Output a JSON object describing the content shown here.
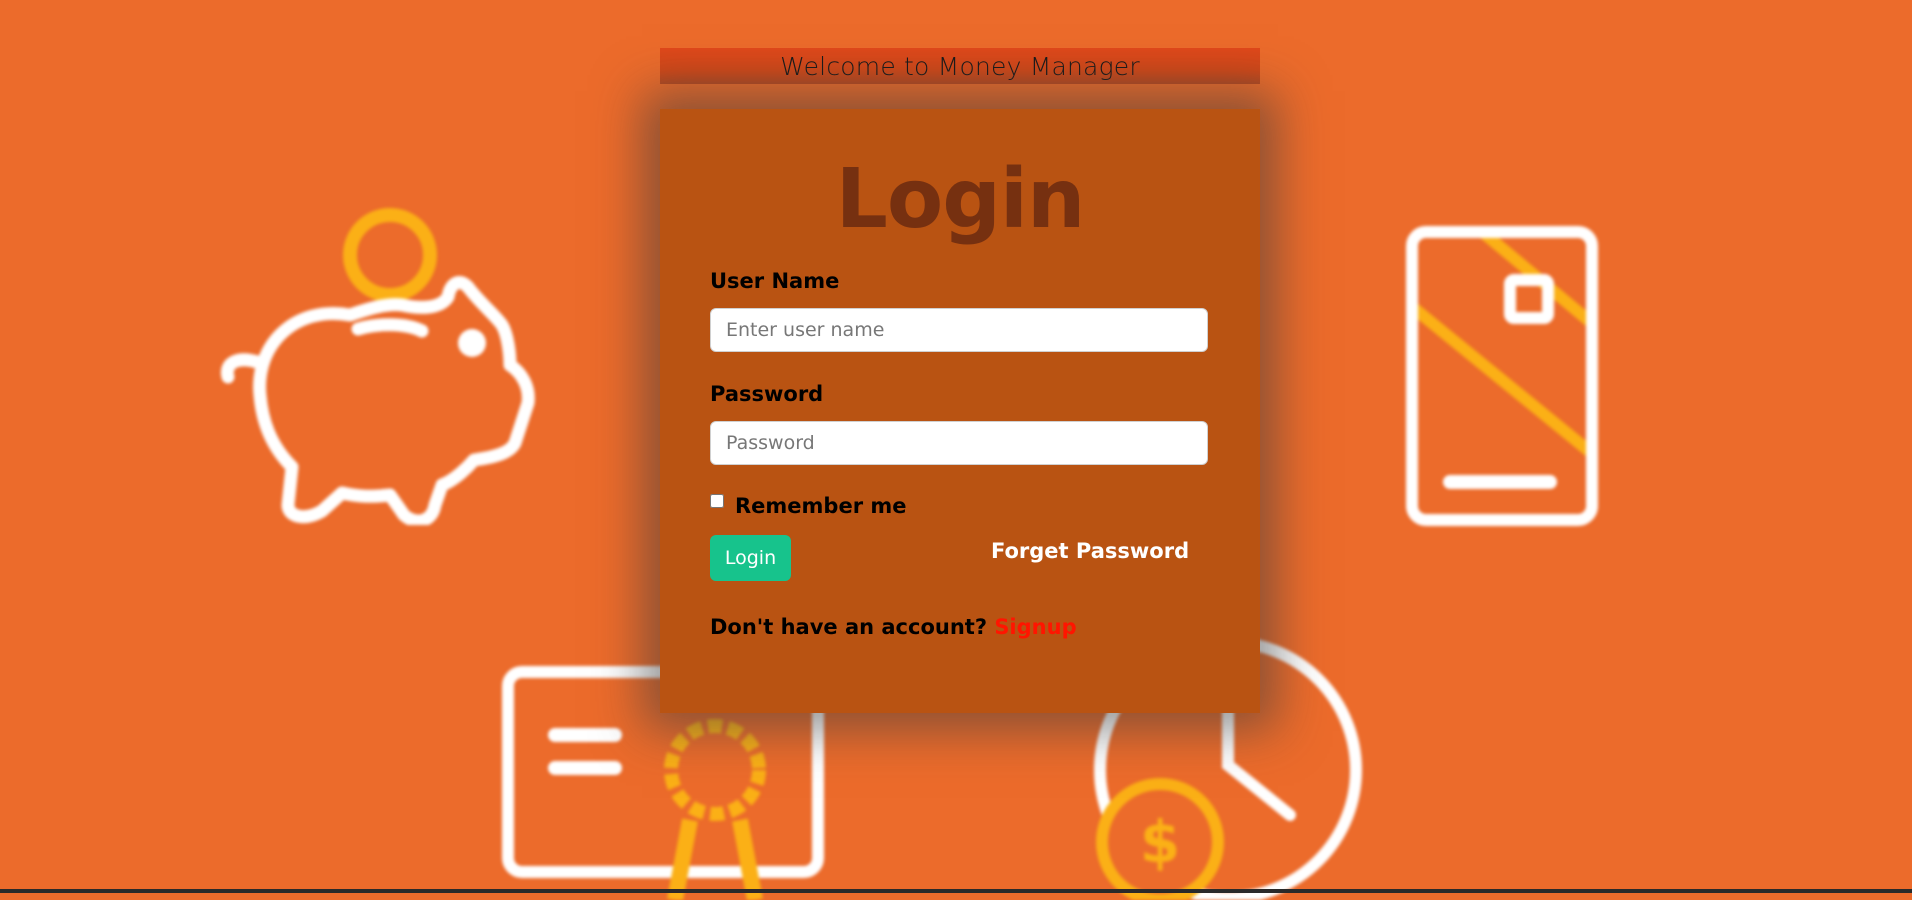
{
  "header": {
    "welcome": "Welcome to Money Manager"
  },
  "login_form": {
    "title": "Login",
    "username_label": "User Name",
    "username_placeholder": "Enter user name",
    "username_value": "",
    "password_label": "Password",
    "password_placeholder": "Password",
    "password_value": "",
    "remember_label": "Remember me",
    "remember_checked": false,
    "login_button": "Login",
    "forget_password": "Forget Password",
    "no_account_text": "Don't have an account?",
    "signup_link": "Signup"
  },
  "background_icons": [
    "piggy-bank-icon",
    "credit-card-icon",
    "certificate-icon",
    "clock-dollar-icon"
  ],
  "colors": {
    "page_background": "#ec6b2b",
    "card_background": "#b95312",
    "title_color": "#763010",
    "login_button": "#17c38c",
    "signup_link": "#ff1500",
    "icon_accent": "#fbb016"
  }
}
